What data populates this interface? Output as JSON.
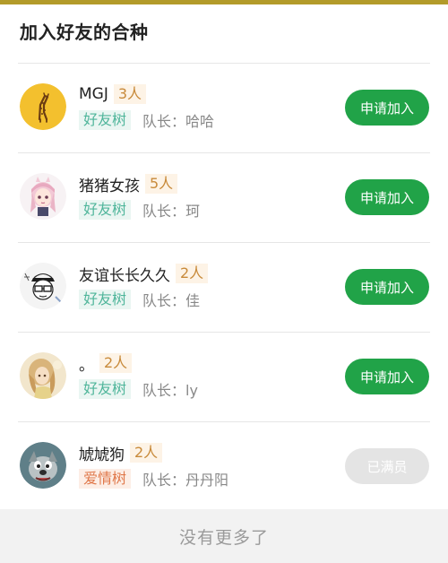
{
  "header": {
    "title": "加入好友的合种"
  },
  "teams": [
    {
      "name": "MGJ",
      "count": "3人",
      "tree": "好友树",
      "tree_type": "friend",
      "captain": "队长：哈哈",
      "action": "申请加入",
      "action_enabled": true,
      "avatar_icon": "giraffe-avatar"
    },
    {
      "name": "猪猪女孩",
      "count": "5人",
      "tree": "好友树",
      "tree_type": "friend",
      "captain": "队长：珂",
      "action": "申请加入",
      "action_enabled": true,
      "avatar_icon": "anime-girl-avatar"
    },
    {
      "name": "友谊长长久久",
      "count": "2人",
      "tree": "好友树",
      "tree_type": "friend",
      "captain": "队长：佳",
      "action": "申请加入",
      "action_enabled": true,
      "avatar_icon": "cartoon-boy-avatar"
    },
    {
      "name": "。",
      "count": "2人",
      "tree": "好友树",
      "tree_type": "friend",
      "captain": "队长：ly",
      "action": "申请加入",
      "action_enabled": true,
      "avatar_icon": "painted-girl-avatar"
    },
    {
      "name": "虓虓狗",
      "count": "2人",
      "tree": "爱情树",
      "tree_type": "love",
      "captain": "队长：丹丹阳",
      "action": "已满员",
      "action_enabled": false,
      "avatar_icon": "cartoon-dog-avatar"
    }
  ],
  "footer": {
    "text": "没有更多了"
  },
  "colors": {
    "accent_green": "#21a348",
    "top_bar": "#b39b2a",
    "count_text": "#c88a3a",
    "friend_tree_text": "#4fb59a",
    "love_tree_text": "#e0784a",
    "disabled_button": "#e4e4e4"
  }
}
